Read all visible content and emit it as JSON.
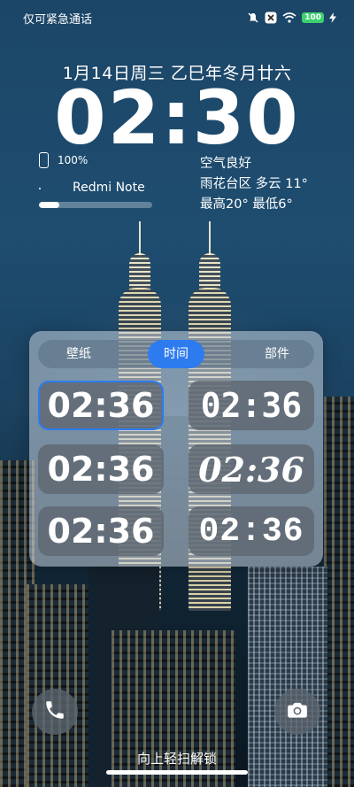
{
  "status_bar": {
    "carrier": "仅可紧急通话",
    "battery": "100",
    "icons": [
      "mute-icon",
      "x-icon",
      "wifi-icon",
      "battery-icon",
      "charging-icon"
    ]
  },
  "lockscreen": {
    "date": "1月14日周三 乙巳年冬月廿六",
    "time": "02:30"
  },
  "device": {
    "battery_percent": "100%",
    "battery_level": 1.0,
    "name": "Redmi Note",
    "progress_fraction": 0.18
  },
  "weather": {
    "air_quality": "空气良好",
    "location_condition": "雨花台区 多云 11°",
    "range": "最高20° 最低6°"
  },
  "editor": {
    "tabs": [
      "壁纸",
      "时间",
      "部件"
    ],
    "active_tab": "时间",
    "clock_styles": [
      "02:36",
      "02:36",
      "02:36",
      "02:36",
      "02:36",
      "02:36"
    ],
    "selected_style_index": 0
  },
  "bottom": {
    "unlock_hint": "向上轻扫解锁"
  }
}
